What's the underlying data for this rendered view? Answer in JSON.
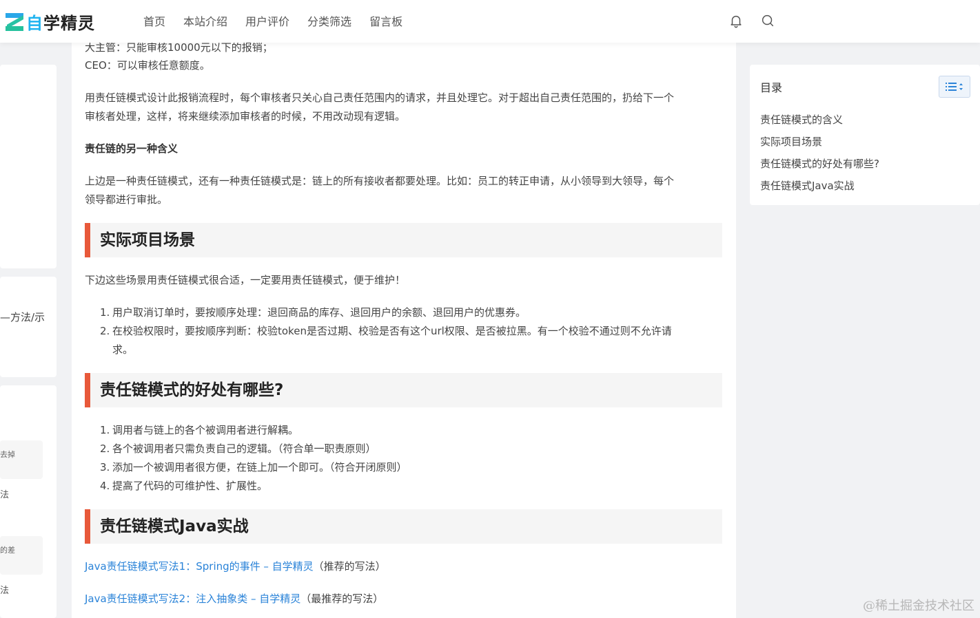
{
  "header": {
    "logo_prefix": "自",
    "logo_rest": "学精灵",
    "nav": [
      "首页",
      "本站介绍",
      "用户评价",
      "分类筛选",
      "留言板"
    ]
  },
  "sidebar_left": {
    "snippet_1": "—方法/示",
    "snippet_2": "去掉",
    "snippet_3": "法",
    "snippet_4": "的差",
    "snippet_5": "法"
  },
  "article": {
    "line_top_cut": "大主管：只能审核10000元以下的报销；",
    "line_ceo": "CEO：可以审核任意额度。",
    "para_1a": "用责任链模式设计此报销流程时，每个审核者只关心自己责任范围内的请求，并且处理它。对于超出自己责任范围的，扔给下一个",
    "para_1b": "审核者处理，这样，将来继续添加审核者的时候，不用改动现有逻辑。",
    "bold_heading": "责任链的另一种含义",
    "para_2a": "上边是一种责任链模式，还有一种责任链模式是：链上的所有接收者都要处理。比如：员工的转正申请，从小领导到大领导，每个",
    "para_2b": "领导都进行审批。",
    "h2_scenario": "实际项目场景",
    "scenario_intro": "下边这些场景用责任链模式很合适，一定要用责任链模式，便于维护！",
    "scenario_list": [
      "用户取消订单时，要按顺序处理：退回商品的库存、退回用户的余额、退回用户的优惠券。",
      "在校验权限时，要按顺序判断：校验token是否过期、校验是否有这个url权限、是否被拉黑。有一个校验不通过则不允许请",
      "求。"
    ],
    "h2_benefits": "责任链模式的好处有哪些?",
    "benefits_list": [
      "调用者与链上的各个被调用者进行解耦。",
      "各个被调用者只需负责自己的逻辑。（符合单一职责原则）",
      "添加一个被调用者很方便，在链上加一个即可。（符合开闭原则）",
      "提高了代码的可维护性、扩展性。"
    ],
    "h2_java": "责任链模式Java实战",
    "link_1": "Java责任链模式写法1：Spring的事件 – 自学精灵",
    "link_1_note": "（推荐的写法）",
    "link_2": "Java责任链模式写法2：注入抽象类 – 自学精灵",
    "link_2_note": "（最推荐的写法）"
  },
  "toc": {
    "title": "目录",
    "items": [
      "责任链模式的含义",
      "实际项目场景",
      "责任链模式的好处有哪些?",
      "责任链模式Java实战"
    ]
  },
  "watermark": "@稀土掘金技术社区",
  "colors": {
    "accent_bar": "#e8593a",
    "link": "#2a83d8",
    "logo_blue": "#1fb3f0"
  }
}
